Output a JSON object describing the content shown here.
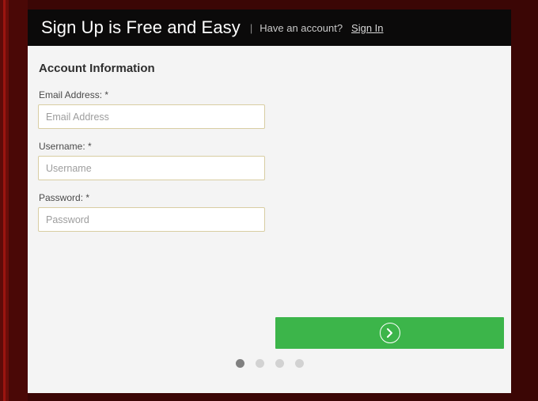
{
  "page": {
    "background_color": "#3b0605",
    "stripe_color": "#9b1410"
  },
  "header": {
    "title": "Sign Up is Free and Easy",
    "divider": "|",
    "account_prompt": "Have an account?",
    "sign_in_label": "Sign In"
  },
  "form": {
    "section_title": "Account Information",
    "fields": [
      {
        "label": "Email Address:",
        "required_marker": "*",
        "placeholder": "Email Address",
        "value": ""
      },
      {
        "label": "Username:",
        "required_marker": "*",
        "placeholder": "Username",
        "value": ""
      },
      {
        "label": "Password:",
        "required_marker": "*",
        "placeholder": "Password",
        "value": ""
      }
    ]
  },
  "footer": {
    "next_button": {
      "label": "",
      "icon": "chevron-right-circle-icon",
      "color": "#3cb54a"
    },
    "steps": {
      "total": 4,
      "active_index": 0,
      "active_color": "#808080",
      "inactive_color": "#d2d2d2"
    }
  }
}
